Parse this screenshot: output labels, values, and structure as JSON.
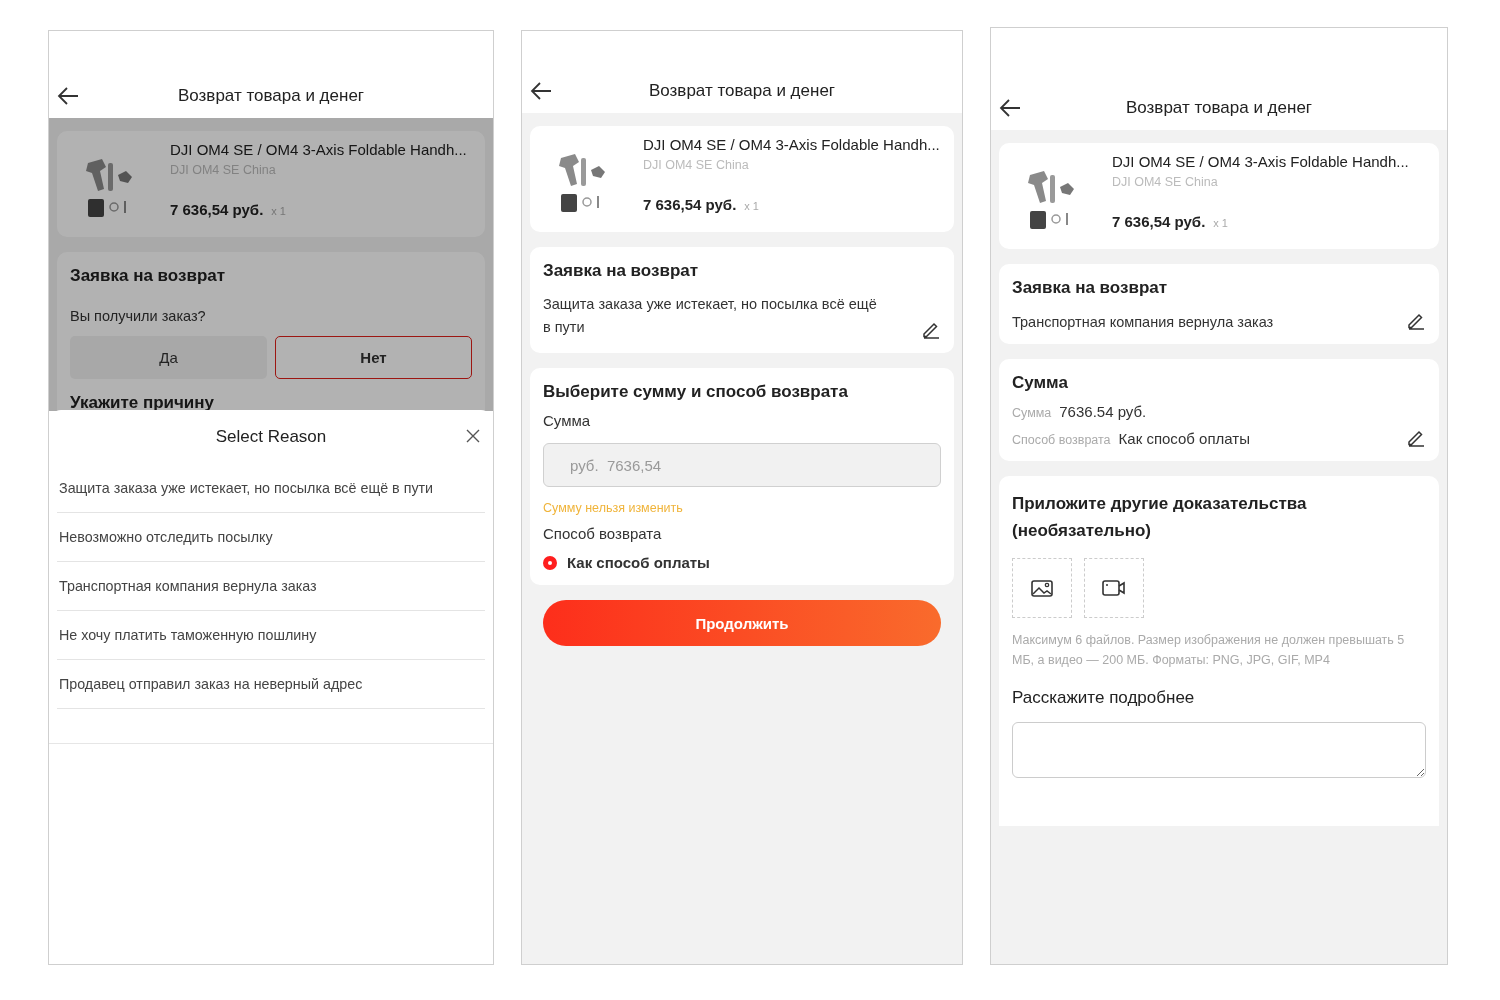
{
  "screens": [
    {
      "kind": "reason_sheet",
      "header": {
        "title": "Возврат товара и денег"
      },
      "product": {
        "title": "DJI OM4 SE / OM4 3-Axis Foldable Handh...",
        "variant": "DJI OM4 SE China",
        "price": "7 636,54 руб.",
        "quantity": "x 1"
      },
      "request": {
        "title": "Заявка на возврат",
        "question": "Вы получили заказ?",
        "options": [
          {
            "label": "Да",
            "selected": false
          },
          {
            "label": "Нет",
            "selected": true
          }
        ],
        "next_heading": "Укажите причину"
      },
      "sheet": {
        "title": "Select Reason",
        "reasons": [
          "Защита заказа уже истекает, но посылка всё ещё в пути",
          "Невозможно отследить посылку",
          "Транспортная компания вернула заказ",
          "Не хочу платить таможенную пошлину",
          "Продавец отправил заказ на неверный адрес"
        ]
      }
    },
    {
      "kind": "amount_form",
      "header": {
        "title": "Возврат товара и денег"
      },
      "product": {
        "title": "DJI OM4 SE / OM4 3-Axis Foldable Handh...",
        "variant": "DJI OM4 SE China",
        "price": "7 636,54 руб.",
        "quantity": "x 1"
      },
      "request": {
        "title": "Заявка на возврат",
        "reason": "Защита заказа уже истекает, но посылка всё ещё в пути"
      },
      "refund": {
        "title": "Выберите сумму и способ возврата",
        "amount_label": "Сумма",
        "amount_field": {
          "value": "руб.  7636,54",
          "disabled": true
        },
        "note": "Сумму нельзя изменить",
        "method_label": "Способ возврата",
        "methods": [
          {
            "label": "Как способ оплаты",
            "selected": true
          }
        ]
      },
      "continue_button": "Продолжить"
    },
    {
      "kind": "summary",
      "header": {
        "title": "Возврат товара и денег"
      },
      "product": {
        "title": "DJI OM4 SE / OM4 3-Axis Foldable Handh...",
        "variant": "DJI OM4 SE China",
        "price": "7 636,54 руб.",
        "quantity": "x 1"
      },
      "request": {
        "title": "Заявка на возврат",
        "reason": "Транспортная компания вернула заказ"
      },
      "amount": {
        "title": "Сумма",
        "rows": [
          {
            "label": "Сумма",
            "value": "7636.54 руб."
          },
          {
            "label": "Способ возврата",
            "value": "Как способ оплаты"
          }
        ]
      },
      "evidence": {
        "title": "Приложите другие доказательства (необязательно)",
        "hint": "Максимум 6 файлов. Размер изображения не должен превышать 5 МБ, а видео — 200 МБ. Форматы: PNG, JPG, GIF, MP4",
        "details_label": "Расскажите подробнее"
      }
    }
  ]
}
